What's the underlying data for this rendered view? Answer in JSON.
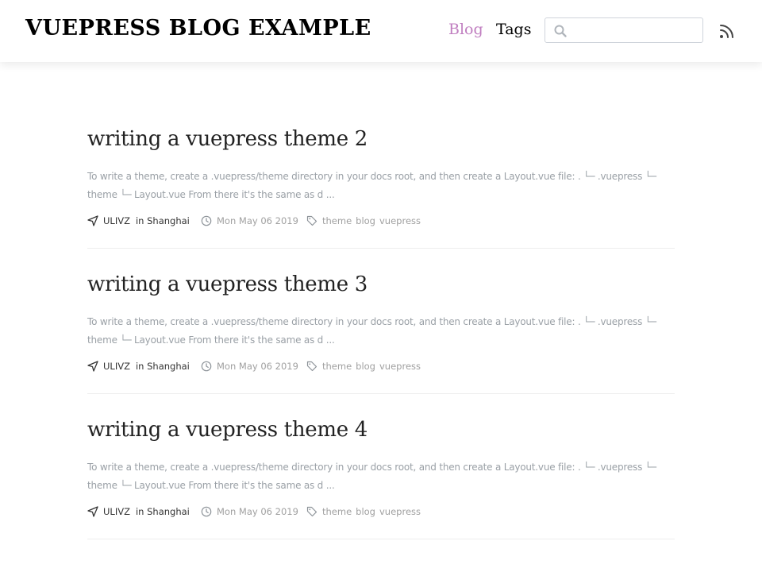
{
  "header": {
    "site_title": "VUEPRESS BLOG EXAMPLE",
    "nav": {
      "blog": "Blog",
      "tags": "Tags"
    },
    "search": {
      "value": "",
      "placeholder": ""
    },
    "colors": {
      "nav_active": "#c07ec0"
    },
    "icons": {
      "search": "search-icon",
      "feed": "rss-icon"
    }
  },
  "posts": [
    {
      "title": "writing a vuepress theme 2",
      "summary": "To write a theme, create a .vuepress/theme directory in your docs root, and then create a Layout.vue file: . └─ .vuepress └─ theme └─ Layout.vue From there it's the same as d ...",
      "author": "ULIVZ",
      "location": "in Shanghai",
      "date": "Mon May 06 2019",
      "tags": [
        "theme",
        "blog",
        "vuepress"
      ]
    },
    {
      "title": "writing a vuepress theme 3",
      "summary": "To write a theme, create a .vuepress/theme directory in your docs root, and then create a Layout.vue file: . └─ .vuepress └─ theme └─ Layout.vue From there it's the same as d ...",
      "author": "ULIVZ",
      "location": "in Shanghai",
      "date": "Mon May 06 2019",
      "tags": [
        "theme",
        "blog",
        "vuepress"
      ]
    },
    {
      "title": "writing a vuepress theme 4",
      "summary": "To write a theme, create a .vuepress/theme directory in your docs root, and then create a Layout.vue file: . └─ .vuepress └─ theme └─ Layout.vue From there it's the same as d ...",
      "author": "ULIVZ",
      "location": "in Shanghai",
      "date": "Mon May 06 2019",
      "tags": [
        "theme",
        "blog",
        "vuepress"
      ]
    }
  ]
}
